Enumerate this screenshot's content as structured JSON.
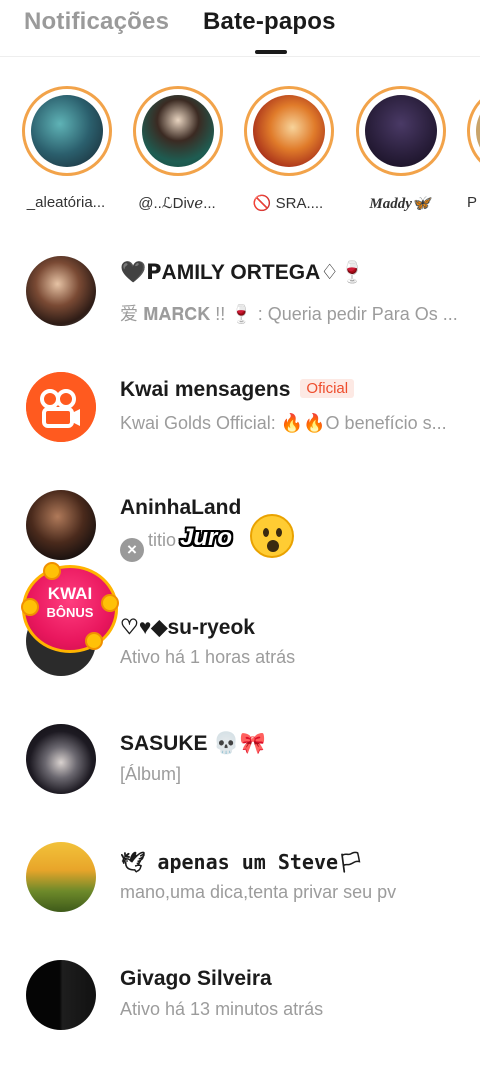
{
  "tabs": [
    {
      "label": "Notificações",
      "active": false
    },
    {
      "label": "Bate-papos",
      "active": true
    }
  ],
  "stories": [
    {
      "name": "_aleatória..."
    },
    {
      "name": "@..ℒDivℯ..."
    },
    {
      "name": "🚫 SRA...."
    },
    {
      "name": "Maddy🦋"
    },
    {
      "name": "P"
    }
  ],
  "chats": [
    {
      "title": "🖤𝗣AMILY ORTEGA♢🍷",
      "subtitle": "爱 𝐌𝐀𝐑𝐂𝐊 !! 🍷 : Queria pedir Para Os ..."
    },
    {
      "title": "Kwai mensagens",
      "badge": "Oficial",
      "subtitle": "Kwai Golds Official: 🔥🔥O benefício s..."
    },
    {
      "title": "AninhaLand",
      "subtitle": "titio"
    },
    {
      "title": "♡♥◆su-ryeok",
      "subtitle": "Ativo há 1 horas atrás"
    },
    {
      "title": "SASUKE 💀🎀",
      "subtitle": "[Álbum]"
    },
    {
      "title": "🕊 apenas um Steve🏳",
      "subtitle": "mano,uma dica,tenta privar seu pv"
    },
    {
      "title": "Givago Silveira",
      "subtitle": "Ativo há 13 minutos atrás"
    }
  ],
  "overlay": {
    "sticker_text": "Juro",
    "bonus_line1": "KWAI",
    "bonus_line2": "BÔNUS",
    "close_glyph": "×"
  },
  "colors": {
    "story_ring": "#f2a34a",
    "kwai_orange": "#ff5a1f",
    "badge_text": "#ee4d2d"
  }
}
